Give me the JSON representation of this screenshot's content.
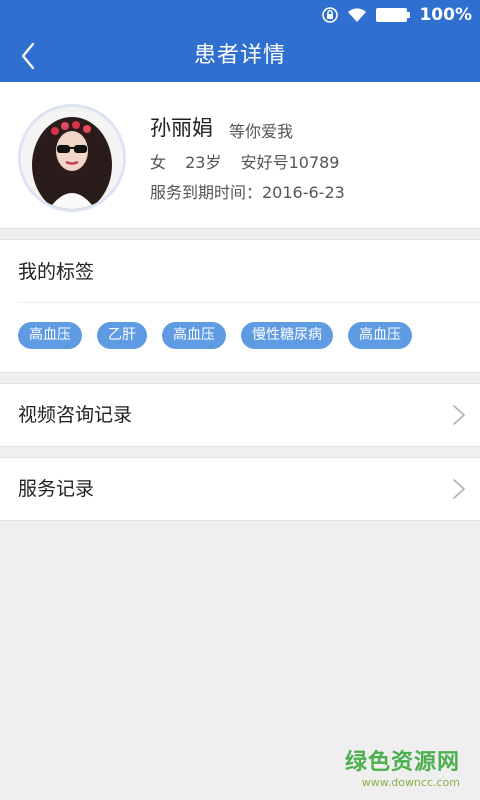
{
  "status_bar": {
    "battery_text": "100%"
  },
  "nav": {
    "title": "患者详情"
  },
  "patient": {
    "name": "孙丽娟",
    "motto": "等你爱我",
    "gender": "女",
    "age": "23岁",
    "id_text": "安好号10789",
    "service_expire": "服务到期时间：2016-6-23"
  },
  "tags": {
    "title": "我的标签",
    "items": [
      "高血压",
      "乙肝",
      "高血压",
      "慢性糖尿病",
      "高血压"
    ]
  },
  "rows": {
    "video_consult": "视频咨询记录",
    "service_records": "服务记录"
  },
  "watermark": {
    "text": "绿色资源网",
    "url": "www.downcc.com"
  },
  "colors": {
    "primary": "#2f6fd0",
    "tag": "#5f9be3"
  }
}
